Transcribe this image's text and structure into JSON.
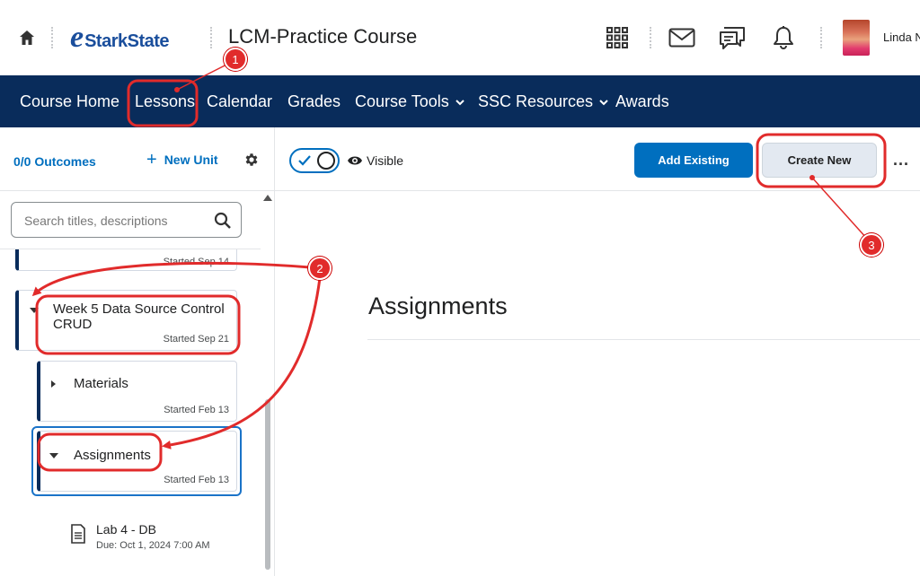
{
  "header": {
    "logo_text": "StarkState",
    "logo_letter": "e",
    "course_title": "LCM-Practice Course",
    "user_name": "Linda N"
  },
  "nav": {
    "items": [
      {
        "label": "Course Home"
      },
      {
        "label": "Lessons"
      },
      {
        "label": "Calendar"
      },
      {
        "label": "Grades"
      },
      {
        "label": "Course Tools"
      },
      {
        "label": "SSC Resources"
      },
      {
        "label": "Awards"
      }
    ]
  },
  "sidebar": {
    "outcomes": "0/0 Outcomes",
    "new_unit": "New Unit",
    "search_placeholder": "Search titles, descriptions",
    "units": [
      {
        "started": "Started Sep 14"
      },
      {
        "title": "Week 5 Data Source Control CRUD",
        "started": "Started Sep 21"
      },
      {
        "title": "Materials",
        "started": "Started Feb 13"
      },
      {
        "title": "Assignments",
        "started": "Started Feb 13"
      }
    ],
    "topic": {
      "title": "Lab 4 - DB",
      "due": "Due: Oct 1, 2024 7:00 AM"
    }
  },
  "toolbar": {
    "visibility_label": "Visible",
    "add_existing": "Add Existing",
    "create_new": "Create New",
    "more": "..."
  },
  "main": {
    "heading": "Assignments"
  },
  "annotations": {
    "badges": [
      "1",
      "2",
      "3"
    ],
    "color": "#e12b2b"
  },
  "colors": {
    "nav_bg": "#092c5b",
    "accent": "#006fbf",
    "selected_border": "#1a73c8"
  }
}
